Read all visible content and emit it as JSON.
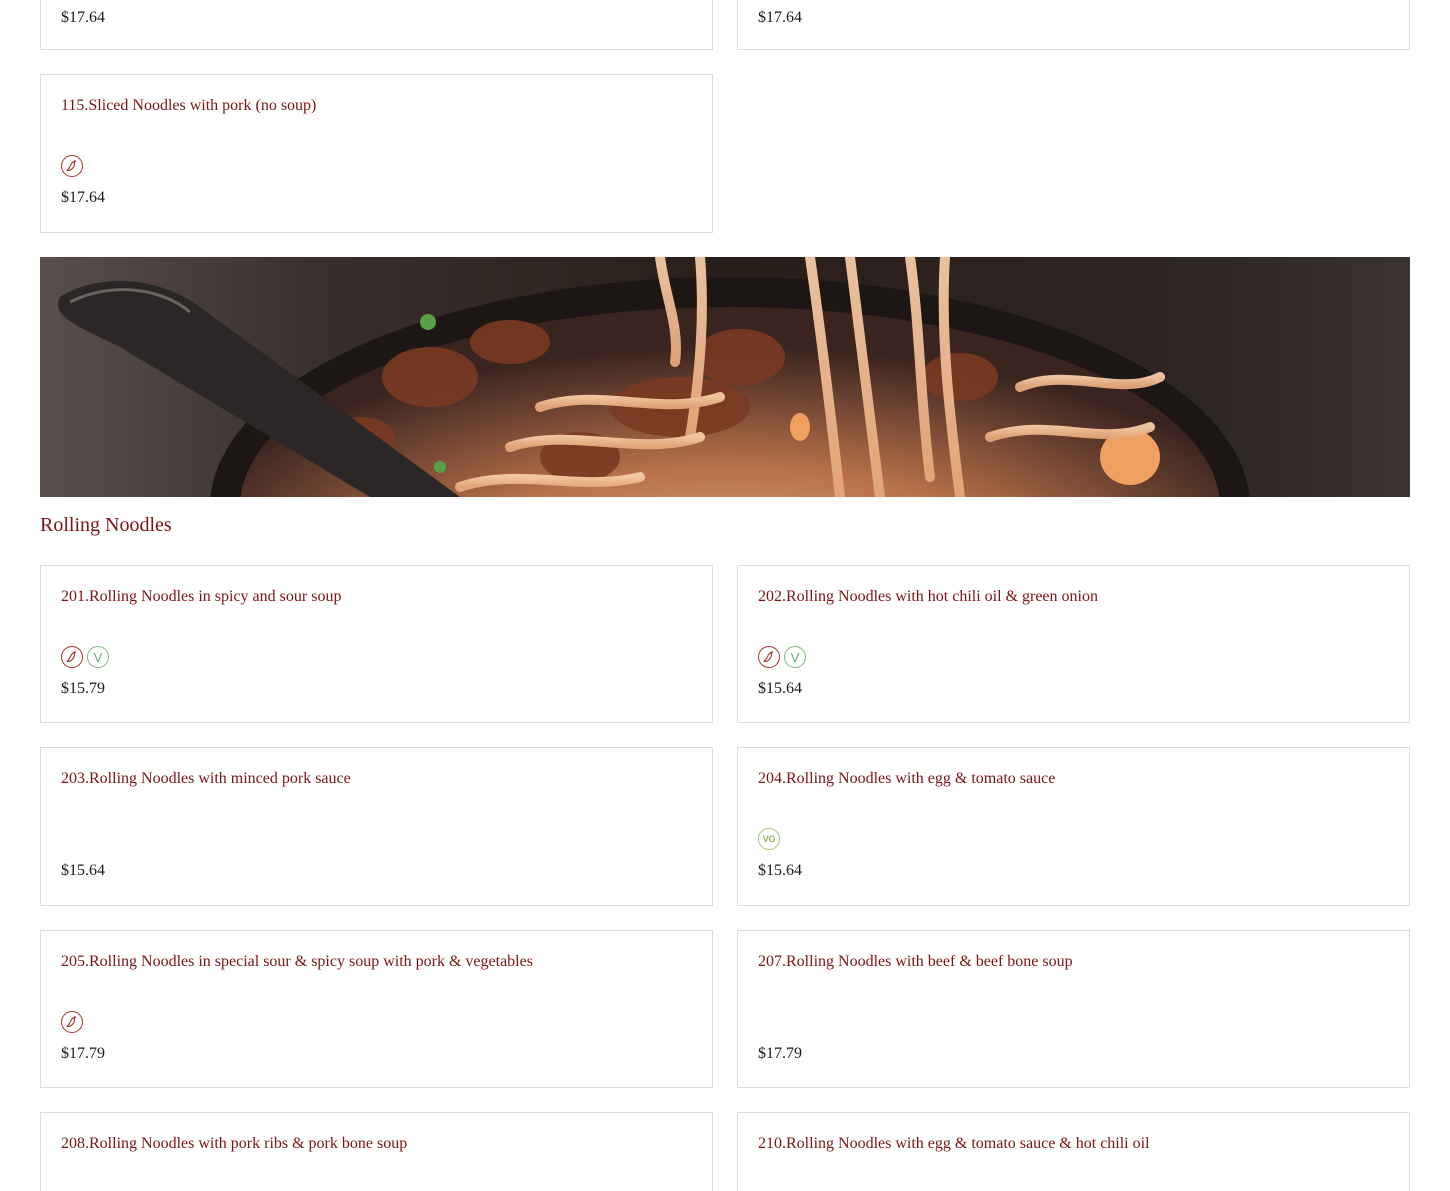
{
  "top_partial": {
    "left_price": "$17.64",
    "right_price": "$17.64"
  },
  "item_115": {
    "name": "115.Sliced Noodles with pork (no soup)",
    "price": "$17.64",
    "tags": [
      "spicy-icon"
    ]
  },
  "section": {
    "title": "Rolling Noodles"
  },
  "items": [
    {
      "name": "201.Rolling Noodles in spicy and sour soup",
      "price": "$15.79",
      "tags": [
        "spicy-icon",
        "vegetarian-icon"
      ]
    },
    {
      "name": "202.Rolling Noodles with hot chili oil & green onion",
      "price": "$15.64",
      "tags": [
        "spicy-icon",
        "vegetarian-icon"
      ]
    },
    {
      "name": "203.Rolling Noodles with minced pork sauce",
      "price": "$15.64",
      "tags": []
    },
    {
      "name": "204.Rolling Noodles with egg & tomato sauce",
      "price": "$15.64",
      "tags": [
        "vegan-icon"
      ]
    },
    {
      "name": "205.Rolling Noodles in special sour & spicy soup with pork & vegetables",
      "price": "$17.79",
      "tags": [
        "spicy-icon"
      ]
    },
    {
      "name": "207.Rolling Noodles with beef & beef bone soup",
      "price": "$17.79",
      "tags": []
    },
    {
      "name": "208.Rolling Noodles with pork ribs & pork bone soup"
    },
    {
      "name": "210.Rolling Noodles with egg & tomato sauce & hot chili oil"
    }
  ],
  "badge_text": {
    "vegetarian": "V",
    "vegan": "VG"
  },
  "colors": {
    "accent": "#7c1414",
    "spicy": "#a3342a",
    "vegetarian": "#6aaa6a",
    "vegan": "#8db35a",
    "border": "#dcdcdc"
  }
}
